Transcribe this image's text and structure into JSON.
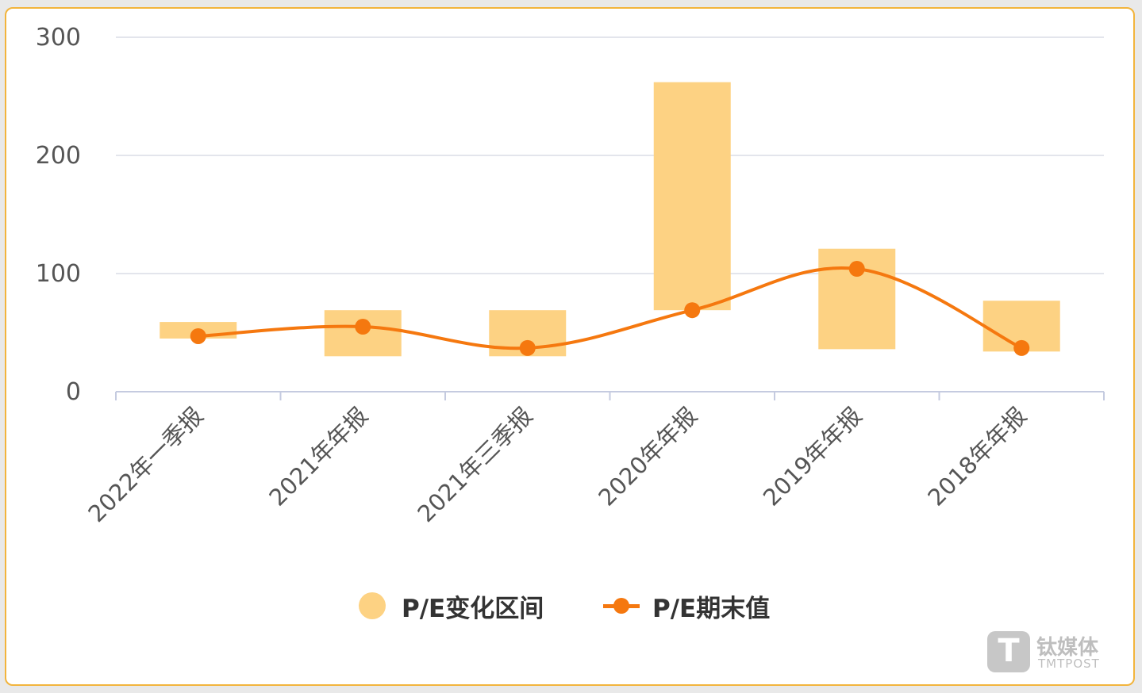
{
  "chart_data": {
    "type": "bar",
    "categories": [
      "2022年一季报",
      "2021年年报",
      "2021年三季报",
      "2020年年报",
      "2019年年报",
      "2018年年报"
    ],
    "series": [
      {
        "name": "P/E变化区间",
        "type": "range-bar",
        "low": [
          45,
          30,
          30,
          69,
          36,
          34
        ],
        "high": [
          59,
          69,
          69,
          262,
          121,
          77
        ]
      },
      {
        "name": "P/E期末值",
        "type": "line",
        "smooth": true,
        "values": [
          47,
          55,
          37,
          69,
          104,
          37
        ]
      }
    ],
    "yticks": [
      "0",
      "100",
      "200",
      "300"
    ],
    "ylim": [
      0,
      300
    ],
    "grid": true,
    "legend_position": "bottom-center"
  },
  "colors": {
    "range": "#fdd283",
    "line": "#f5780f",
    "grid": "#e3e5ec",
    "axis": "#c5cbe0",
    "border": "#f2b43c"
  },
  "watermark": {
    "logo_letter": "T",
    "cn": "钛媒体",
    "en": "TMTPOST"
  }
}
